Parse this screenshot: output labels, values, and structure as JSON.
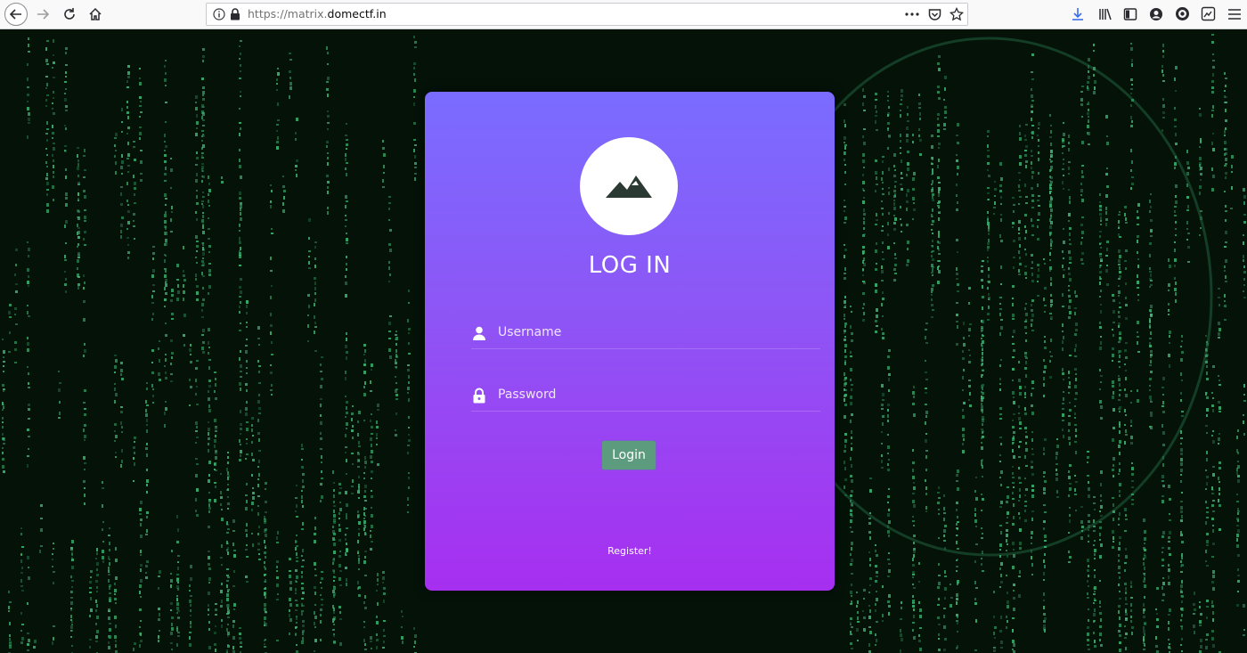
{
  "browser": {
    "url_prefix": "https://matrix.",
    "url_domain": "domectf.in",
    "icons": [
      "back-icon",
      "forward-icon",
      "reload-icon",
      "home-icon",
      "info-icon",
      "lock-icon",
      "more-icon",
      "pocket-icon",
      "star-icon",
      "download-icon",
      "library-icon",
      "sidebar-icon",
      "account-icon",
      "extension-icon",
      "screenshot-icon",
      "menu-icon"
    ]
  },
  "login": {
    "title": "LOG IN",
    "username_placeholder": "Username",
    "password_placeholder": "Password",
    "login_label": "Login",
    "register_label": "Register!"
  },
  "colors": {
    "card_top": "#7a6cff",
    "card_bottom": "#a72ff0",
    "button": "#5d9b7e",
    "matrix_green": "#3fbf7a",
    "background": "#041208"
  }
}
